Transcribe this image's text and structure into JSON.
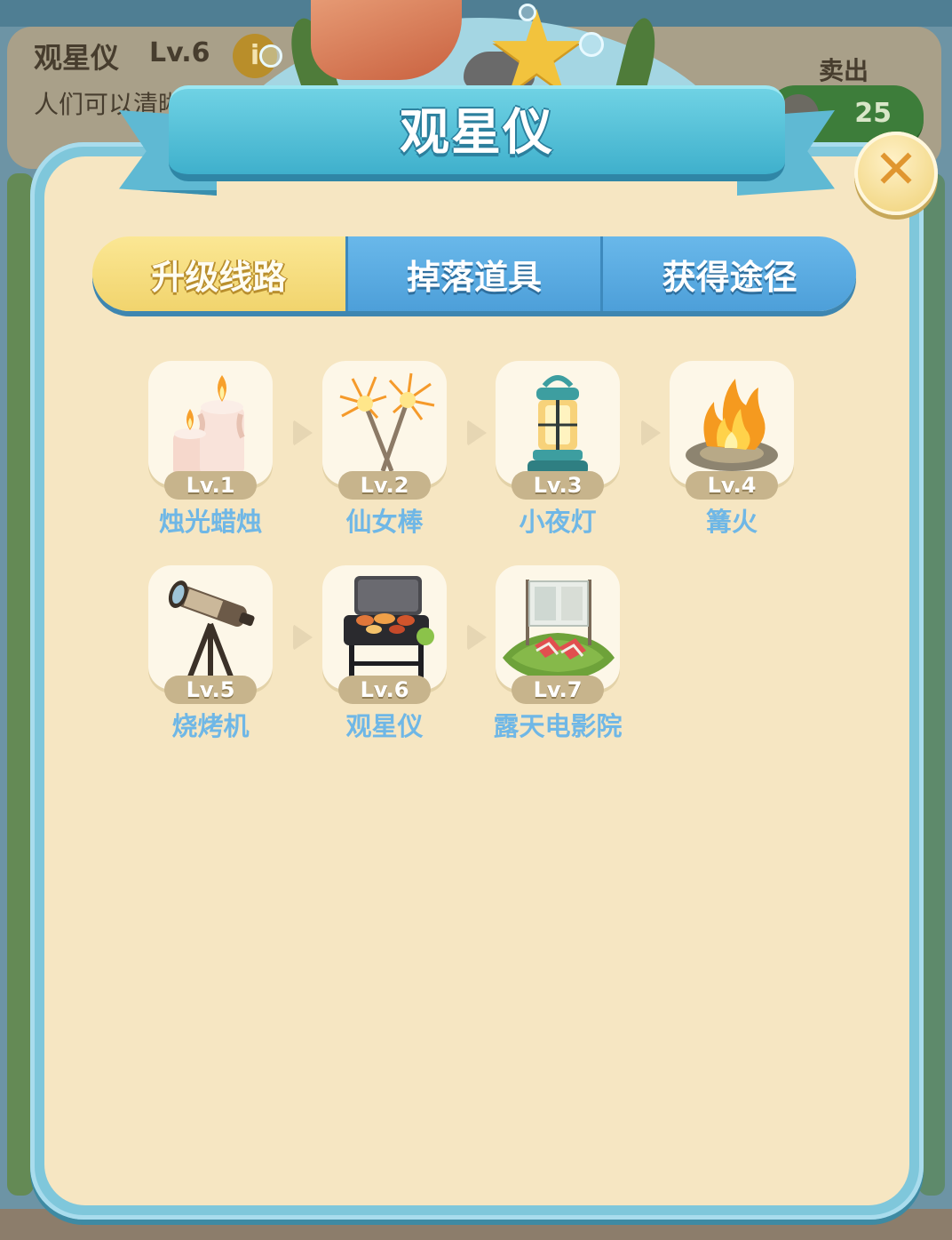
{
  "background": {
    "item_title": "观星仪",
    "item_level": "Lv.6",
    "info_icon": "i",
    "item_description": "人们可以清晰地",
    "sell_label": "卖出",
    "sell_price": "25"
  },
  "modal": {
    "title": "观星仪",
    "close_icon": "✕",
    "tabs": [
      {
        "label": "升级线路",
        "active": true
      },
      {
        "label": "掉落道具",
        "active": false
      },
      {
        "label": "获得途径",
        "active": false
      }
    ]
  },
  "upgrade_path": [
    {
      "level": "Lv.1",
      "name": "烛光蜡烛",
      "icon": "candles-icon"
    },
    {
      "level": "Lv.2",
      "name": "仙女棒",
      "icon": "sparklers-icon"
    },
    {
      "level": "Lv.3",
      "name": "小夜灯",
      "icon": "lantern-icon"
    },
    {
      "level": "Lv.4",
      "name": "篝火",
      "icon": "campfire-icon"
    },
    {
      "level": "Lv.5",
      "name": "烧烤机",
      "icon": "telescope-icon"
    },
    {
      "level": "Lv.6",
      "name": "观星仪",
      "icon": "grill-icon"
    },
    {
      "level": "Lv.7",
      "name": "露天电影院",
      "icon": "outdoor-cinema-icon"
    }
  ],
  "colors": {
    "modal_border": "#7fc7db",
    "modal_fill": "#f6e6c2",
    "tab_active": "#f1d46d",
    "tab_inactive": "#4d9fd9",
    "item_name": "#6fb7e6"
  }
}
